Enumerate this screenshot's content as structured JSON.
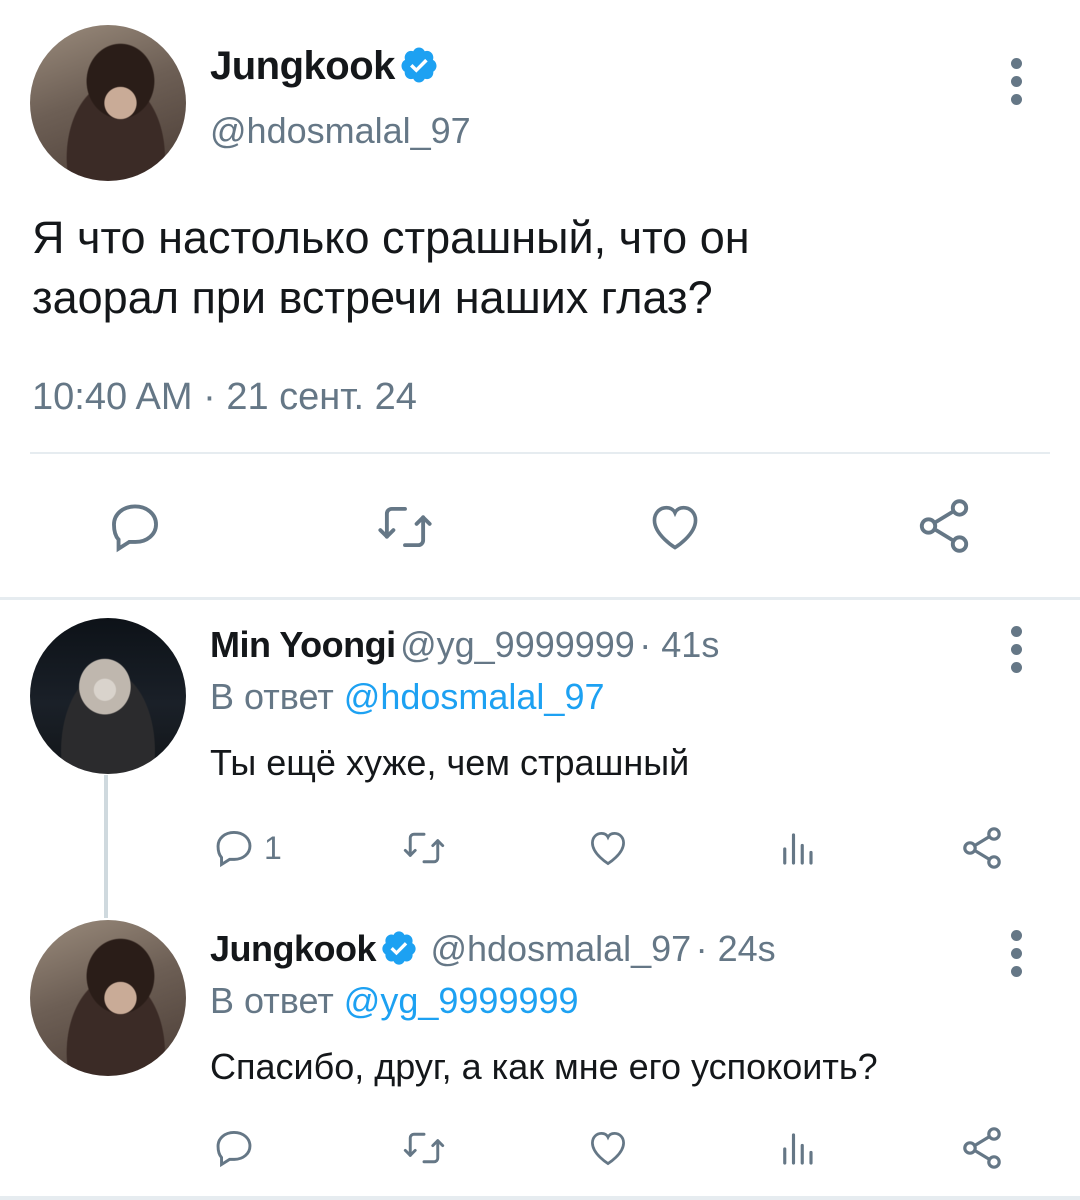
{
  "main_tweet": {
    "author": "Jungkook",
    "verified": true,
    "handle": "@hdosmalal_97",
    "text_line1": "Я что настолько страшный, что он",
    "text_line2": "заорал при встречи наших глаз?",
    "timestamp": "10:40 AM · 21 сент. 24"
  },
  "replies": [
    {
      "author": "Min Yoongi",
      "verified": false,
      "handle": "@yg_9999999",
      "time": "· 41s",
      "reply_prefix": "В ответ",
      "reply_to": "@hdosmalal_97",
      "text": "Ты ещё хуже, чем страшный",
      "reply_count": "1"
    },
    {
      "author": "Jungkook",
      "verified": true,
      "handle": "@hdosmalal_97",
      "time": "· 24s",
      "reply_prefix": "В ответ",
      "reply_to": "@yg_9999999",
      "text": "Спасибо, друг, а как мне его успокоить?",
      "reply_count": ""
    }
  ],
  "icons": {
    "reply": "comment-bubble-icon",
    "retweet": "retweet-icon",
    "like": "heart-icon",
    "views": "analytics-icon",
    "share": "share-icon",
    "more": "more-vertical-icon",
    "verified": "verified-badge-icon"
  },
  "colors": {
    "text": "#14171a",
    "secondary": "#657786",
    "link": "#1da1f2",
    "verified": "#1da1f2",
    "divider": "#e6ecf0"
  }
}
